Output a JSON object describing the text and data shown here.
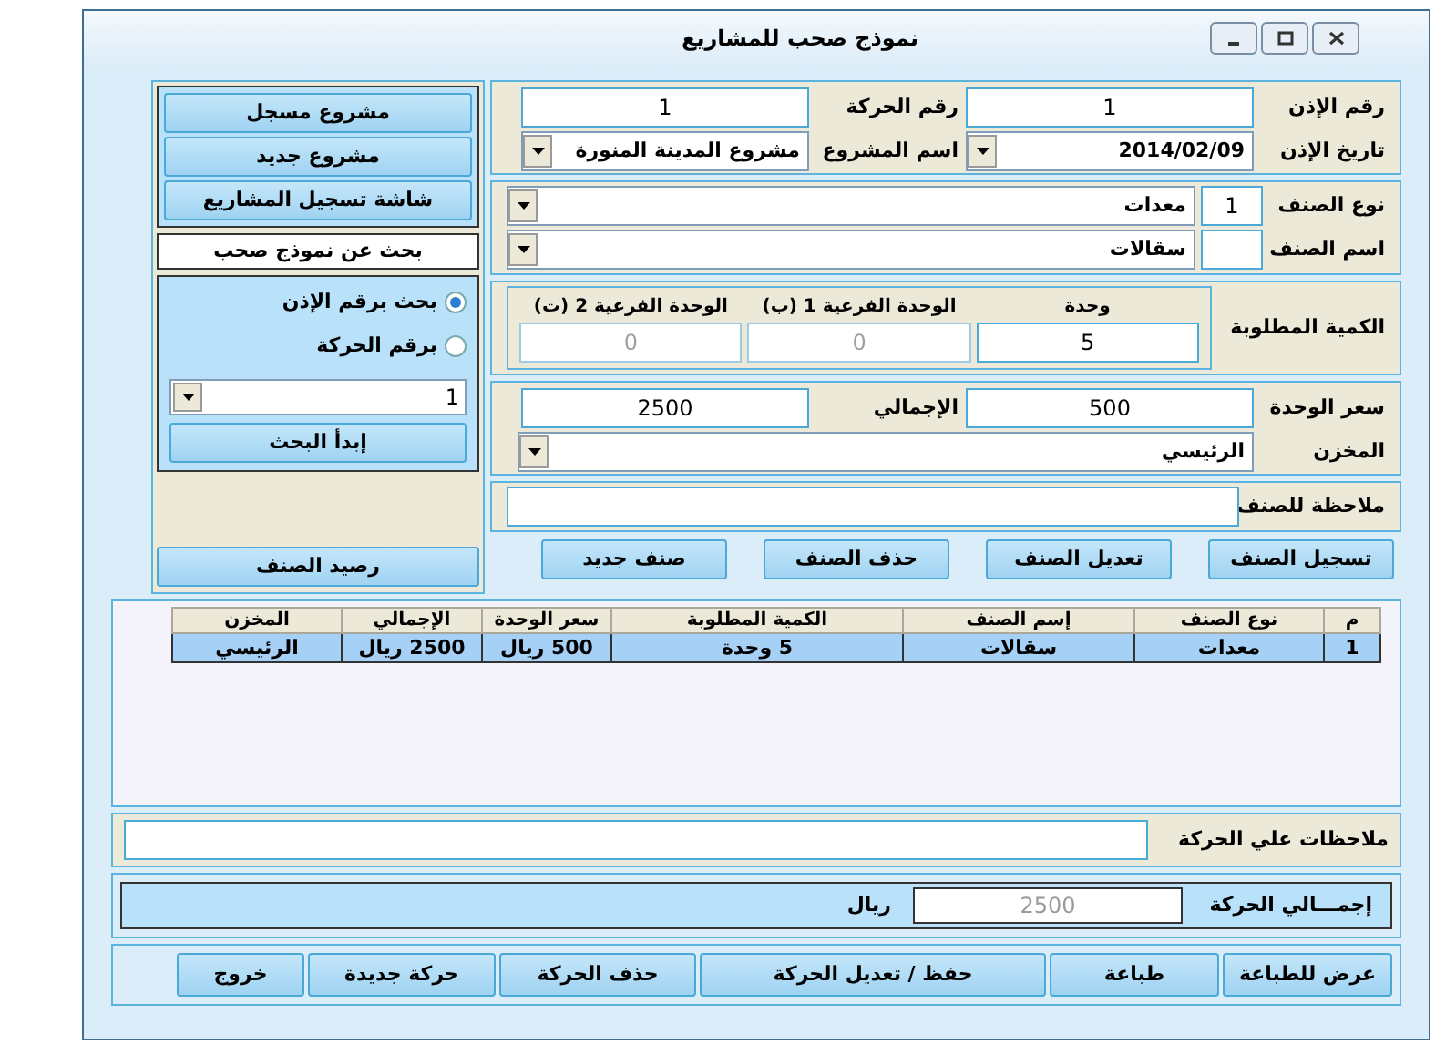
{
  "window": {
    "title": "نموذج صحب للمشاريع"
  },
  "header": {
    "fields": [
      {
        "label": "رقم الإذن",
        "value": "1",
        "kind": "text"
      },
      {
        "label": "رقم الحركة",
        "value": "1",
        "kind": "text"
      },
      {
        "label": "تاريخ الإذن",
        "value": "2014/02/09",
        "kind": "dropdown"
      },
      {
        "label": "اسم المشروع",
        "value": "مشروع المدينة المنورة",
        "kind": "dropdown"
      }
    ]
  },
  "item": {
    "type_label": "نوع الصنف",
    "type_code": "1",
    "type_value": "معدات",
    "name_label": "اسم الصنف",
    "name_value": "سقالات"
  },
  "quantity": {
    "label": "الكمية المطلوبة",
    "units": [
      {
        "label": "وحدة",
        "value": "5",
        "disabled": false
      },
      {
        "label": "الوحدة الفرعية 1 (ب)",
        "value": "0",
        "disabled": true
      },
      {
        "label": "الوحدة الفرعية 2 (ت)",
        "value": "0",
        "disabled": true
      }
    ]
  },
  "price": {
    "unit_label": "سعر الوحدة",
    "unit_value": "500",
    "total_label": "الإجمالي",
    "total_value": "2500",
    "store_label": "المخزن",
    "store_value": "الرئيسي"
  },
  "item_note": {
    "label": "ملاحظة للصنف"
  },
  "item_buttons": [
    "تسجيل الصنف",
    "تعديل الصنف",
    "حذف الصنف",
    "صنف جديد"
  ],
  "sidebar": {
    "buttons": [
      "مشروع مسجل",
      "مشروع جديد",
      "شاشة تسجيل المشاريع"
    ],
    "search_title": "بحث عن نموذج صحب",
    "options": [
      {
        "label": "بحث برقم الإذن",
        "selected": true
      },
      {
        "label": "برقم الحركة",
        "selected": false
      }
    ],
    "search_value": "1",
    "search_button": "إبدأ البحث",
    "balance_button": "رصيد الصنف"
  },
  "table": {
    "columns": [
      "م",
      "نوع الصنف",
      "إسم الصنف",
      "الكمية المطلوبة",
      "سعر الوحدة",
      "الإجمالي",
      "المخزن"
    ],
    "rows": [
      {
        "cells": [
          "1",
          "معدات",
          "سقالات",
          "5 وحدة",
          "500 ريال",
          "2500 ريال",
          "الرئيسي"
        ],
        "selected": true
      }
    ]
  },
  "movement_notes": {
    "label": "ملاحظات علي الحركة"
  },
  "total": {
    "label": "إجمـــالي الحركة",
    "value": "2500",
    "disabled": true,
    "currency": "ريال"
  },
  "footer_buttons": [
    "عرض للطباعة",
    "طباعة",
    "حفظ / تعديل الحركة",
    "حذف الحركة",
    "حركة جديدة",
    "خروج"
  ]
}
